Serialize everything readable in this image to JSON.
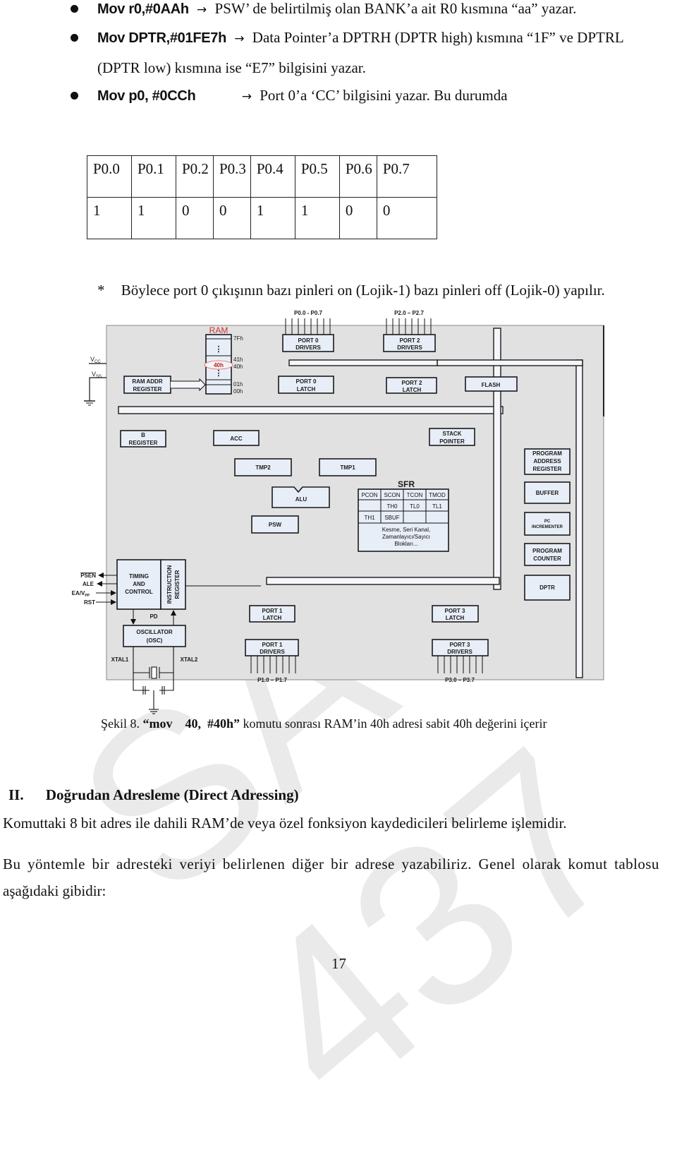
{
  "bullets": [
    {
      "code": "Mov r0,#0AAh",
      "arrow": "→",
      "text": "PSW’ de belirtilmiş olan BANK’a ait R0 kısmına “aa” yazar."
    },
    {
      "code": "Mov  DPTR,#01FE7h",
      "arrow": "→",
      "text": "Data Pointer’a DPTRH (DPTR high) kısmına “1F” ve DPTRL",
      "continuation": "(DPTR low) kısmına ise “E7” bilgisini yazar."
    },
    {
      "code": "Mov p0, #0CCh",
      "arrow": "→",
      "text": "Port 0’a ‘CC’ bilgisini yazar. Bu durumda"
    }
  ],
  "port_table": {
    "headers": [
      "P0.0",
      "P0.1",
      "P0.2",
      "P0.3",
      "P0.4",
      "P0.5",
      "P0.6",
      "P0.7"
    ],
    "values": [
      "1",
      "1",
      "0",
      "0",
      "1",
      "1",
      "0",
      "0"
    ]
  },
  "note": {
    "marker": "*",
    "text": "Böylece port 0 çıkışının bazı pinleri on (Lojik-1) bazı pinleri off (Lojik-0) yapılır."
  },
  "diagram": {
    "pins_port0": "P0.0 - P0.7",
    "pins_port2": "P2.0 – P2.7",
    "pins_port1": "P1.0 – P1.7",
    "pins_port3": "P3.0 – P3.7",
    "vcc": "V",
    "vcc_sub": "CC",
    "vss": "V",
    "vss_sub": "SS",
    "ram_title": "RAM",
    "ram_highlight": "40h",
    "ram_addresses": [
      "7Fh",
      "41h",
      "40h",
      "01h",
      "00h"
    ],
    "ram_dots": "⋮",
    "blocks": {
      "ram_addr_1": "RAM ADDR",
      "ram_addr_2": "REGISTER",
      "port0_drivers_1": "PORT 0",
      "port0_drivers_2": "DRIVERS",
      "port0_latch_1": "PORT 0",
      "port0_latch_2": "LATCH",
      "port2_drivers_1": "PORT 2",
      "port2_drivers_2": "DRIVERS",
      "port2_latch_1": "PORT 2",
      "port2_latch_2": "LATCH",
      "flash": "FLASH",
      "b_reg_1": "B",
      "b_reg_2": "REGISTER",
      "acc": "ACC",
      "stack_1": "STACK",
      "stack_2": "POINTER",
      "tmp2": "TMP2",
      "tmp1": "TMP1",
      "alu": "ALU",
      "psw": "PSW",
      "par_1": "PROGRAM",
      "par_2": "ADDRESS",
      "par_3": "REGISTER",
      "buffer": "BUFFER",
      "pcinc_1": "PC",
      "pcinc_2": "INCREMENTER",
      "pc_1": "PROGRAM",
      "pc_2": "COUNTER",
      "dptr": "DPTR",
      "timing_1": "TIMING",
      "timing_2": "AND",
      "timing_3": "CONTROL",
      "ir_1": "INSTRUCTION",
      "ir_2": "REGISTER",
      "pd": "PD",
      "osc_1": "OSCILLATOR",
      "osc_2": "(OSC)",
      "xtal1": "XTAL1",
      "xtal2": "XTAL2",
      "port1_latch_1": "PORT 1",
      "port1_latch_2": "LATCH",
      "port1_drivers_1": "PORT 1",
      "port1_drivers_2": "DRIVERS",
      "port3_latch_1": "PORT 3",
      "port3_latch_2": "LATCH",
      "port3_drivers_1": "PORT 3",
      "port3_drivers_2": "DRIVERS"
    },
    "sfr": {
      "title": "SFR",
      "rows": [
        [
          "PCON",
          "SCON",
          "TCON",
          "TMOD"
        ],
        [
          "",
          "TH0",
          "TL0",
          "TL1"
        ],
        [
          "TH1",
          "SBUF",
          "",
          ""
        ]
      ],
      "desc_1": "Kesme, Seri Kanal,",
      "desc_2": "Zamanlayıcı/Sayıcı",
      "desc_3": "Blokları..."
    },
    "control_pins": [
      "PSEN",
      "ALE",
      "EA/V",
      "RST"
    ],
    "ea_sub": "PP"
  },
  "caption": {
    "prefix": "Şekil 8.",
    "bold": "“mov    40,  #40h”",
    "text": "komutu sonrası RAM’in 40h adresi  sabit 40h değerini içerir"
  },
  "section": {
    "number": "II.",
    "title": "Doğrudan Adresleme (Direct Adressing)"
  },
  "paragraphs": [
    "Komuttaki 8 bit adres ile dahili RAM’de veya özel fonksiyon kaydedicileri belirleme işlemidir.",
    "Bu yöntemle bir adresteki veriyi belirlenen diğer bir adrese yazabiliriz. Genel olarak komut tablosu",
    "aşağıdaki gibidir:"
  ],
  "page_number": "17",
  "watermark": "SA 437"
}
